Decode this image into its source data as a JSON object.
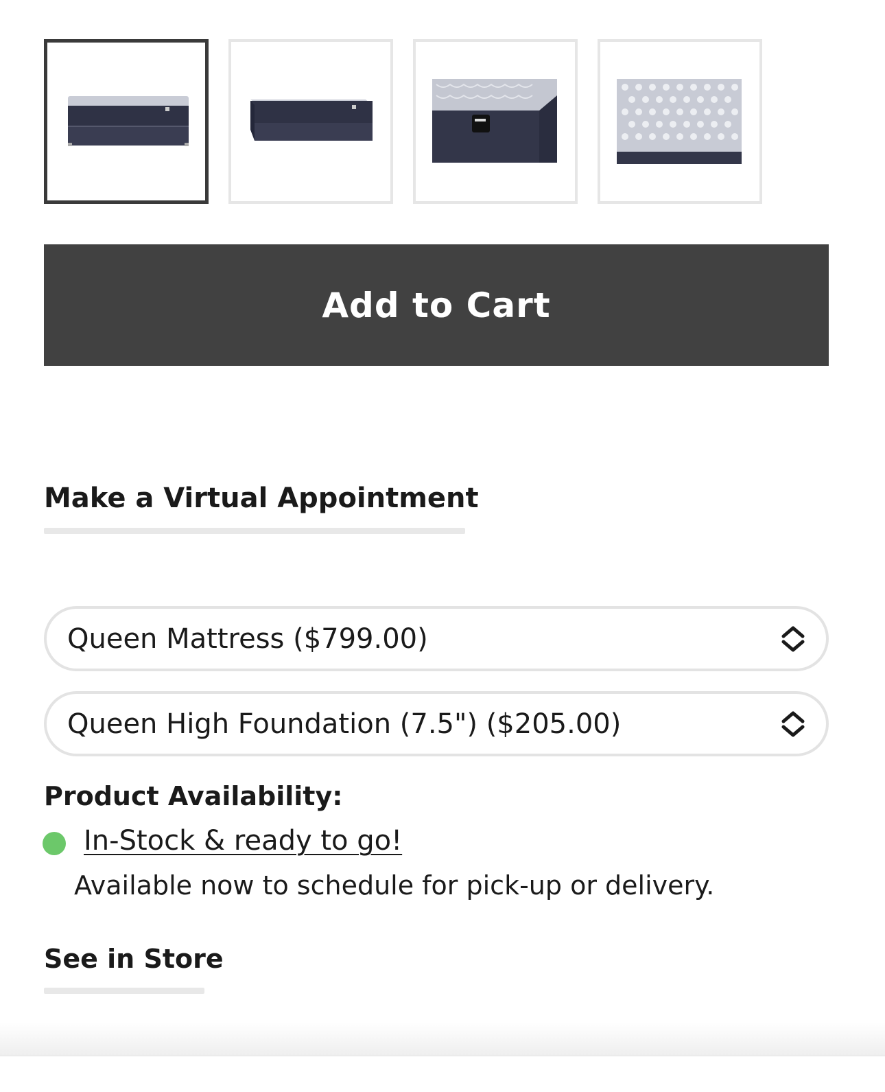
{
  "gallery": {
    "thumbnails": [
      {
        "icon": "mattress-foundation-front-image",
        "selected": true
      },
      {
        "icon": "mattress-foundation-angle-image",
        "selected": false
      },
      {
        "icon": "mattress-corner-label-image",
        "selected": false
      },
      {
        "icon": "mattress-quilted-top-image",
        "selected": false
      }
    ]
  },
  "cart": {
    "add_label": "Add to Cart"
  },
  "appointment": {
    "label": "Make a Virtual Appointment"
  },
  "options": {
    "mattress_select": {
      "value": "Queen Mattress ($799.00)"
    },
    "foundation_select": {
      "value": "Queen High Foundation (7.5\") ($205.00)"
    }
  },
  "availability": {
    "title": "Product Availability:",
    "status_label": "In-Stock & ready to go!",
    "status_detail": "Available now to schedule for pick-up or delivery.",
    "status_color": "#6cc86a"
  },
  "store": {
    "label": "See in Store"
  },
  "colors": {
    "button_bg": "#414141",
    "border_light": "#e3e3e3",
    "selected_border": "#3a3a3a"
  }
}
